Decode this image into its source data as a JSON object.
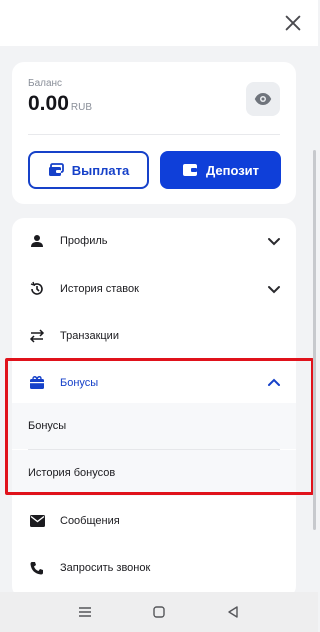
{
  "header": {
    "close_icon": "close-icon"
  },
  "balance": {
    "label": "Баланс",
    "amount": "0.00",
    "currency": "RUB",
    "toggle_icon": "eye-icon"
  },
  "actions": {
    "payout_label": "Выплата",
    "deposit_label": "Депозит"
  },
  "menu": {
    "items": [
      {
        "label": "Профиль",
        "icon": "person-icon",
        "has_chevron": true
      },
      {
        "label": "История ставок",
        "icon": "history-icon",
        "has_chevron": true
      },
      {
        "label": "Транзакции",
        "icon": "transfer-icon",
        "has_chevron": false
      },
      {
        "label": "Бонусы",
        "icon": "gift-icon",
        "has_chevron": true,
        "expanded": true
      },
      {
        "label": "Сообщения",
        "icon": "envelope-icon",
        "has_chevron": false
      },
      {
        "label": "Запросить звонок",
        "icon": "phone-icon",
        "has_chevron": false
      }
    ],
    "bonus_submenu": [
      {
        "label": "Бонусы"
      },
      {
        "label": "История бонусов"
      }
    ]
  },
  "colors": {
    "accent": "#0f3fd9",
    "highlight": "#e0121b"
  },
  "system_nav": {
    "buttons": [
      "menu-icon",
      "home-icon",
      "back-icon"
    ]
  }
}
